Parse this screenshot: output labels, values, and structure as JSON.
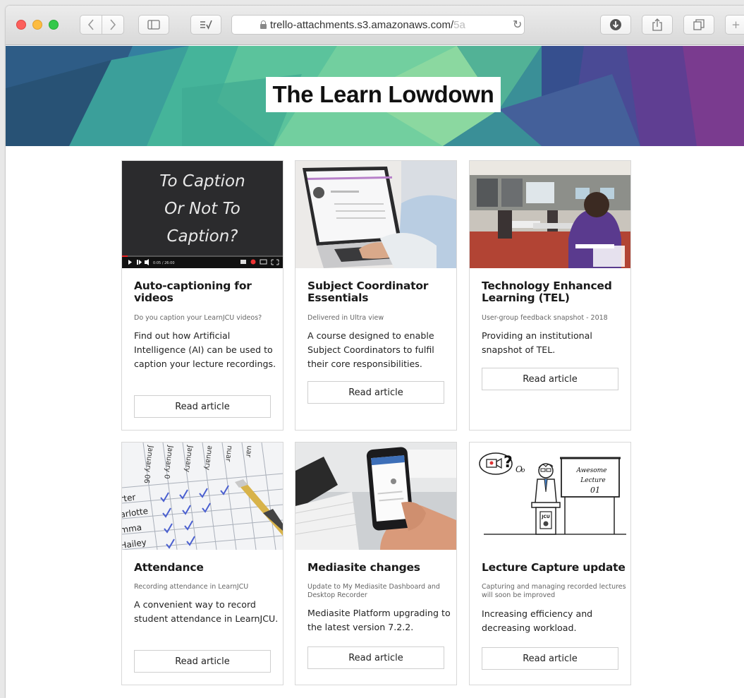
{
  "browser": {
    "url": "trello-attachments.s3.amazonaws.com/",
    "url_faded": "5a",
    "back_icon": "chevron-left-icon",
    "forward_icon": "chevron-right-icon"
  },
  "banner": {
    "title": "The Learn Lowdown",
    "colors": [
      "#2f5d86",
      "#3aa48f",
      "#7fd39d",
      "#3d4f8a",
      "#6b3a8c"
    ]
  },
  "thumbnails": {
    "caption": {
      "lines": [
        "To Caption",
        "Or Not To",
        "Caption?"
      ],
      "time": "0:05 / 26:00"
    },
    "lecture": {
      "board_lines": [
        "Awesome",
        "Lecture",
        "01"
      ],
      "podium_label": "JCU"
    },
    "attendance": {
      "names": [
        "rter",
        "arlotte",
        "mma",
        "Hailey"
      ],
      "columns": [
        "January 06",
        "January 0",
        "January",
        "anuary",
        "nuar",
        "uar"
      ]
    }
  },
  "cards": [
    {
      "title": "Auto-captioning for videos",
      "subtitle": "Do you caption your LearnJCU videos?",
      "description": "Find out how Artificial Intelligence (AI) can be used to caption your lecture recordings.",
      "button": "Read article"
    },
    {
      "title": "Subject Coordinator Essentials",
      "subtitle": "Delivered in Ultra view",
      "description": "A course designed to enable Subject Coordinators to fulfil their core responsibilities.",
      "button": "Read article"
    },
    {
      "title": "Technology Enhanced Learning (TEL)",
      "subtitle": "User-group feedback snapshot - 2018",
      "description": "Providing an institutional snapshot of TEL.",
      "button": "Read article"
    },
    {
      "title": "Attendance",
      "subtitle": "Recording attendance in LearnJCU",
      "description": "A convenient way to record student attendance in LearnJCU.",
      "button": "Read article"
    },
    {
      "title": "Mediasite changes",
      "subtitle": "Update to My Mediasite Dashboard and Desktop Recorder",
      "description": "Mediasite Platform upgrading to the latest version 7.2.2.",
      "button": "Read article"
    },
    {
      "title": "Lecture Capture update",
      "subtitle": "Capturing and managing recorded lectures will soon be improved",
      "description": "Increasing efficiency and decreasing workload.",
      "button": "Read article"
    }
  ]
}
